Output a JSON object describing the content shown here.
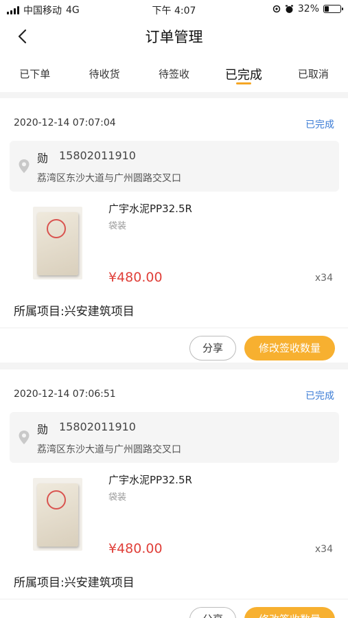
{
  "status_bar": {
    "carrier": "中国移动",
    "network": "4G",
    "time": "下午 4:07",
    "battery": "32%",
    "battery_level": 0.32
  },
  "nav": {
    "title": "订单管理"
  },
  "tabs": [
    {
      "label": "已下单"
    },
    {
      "label": "待收货"
    },
    {
      "label": "待签收"
    },
    {
      "label": "已完成"
    },
    {
      "label": "已取消"
    }
  ],
  "active_tab": "已完成",
  "orders": [
    {
      "datetime": "2020-12-14 07:07:04",
      "status": "已完成",
      "recipient_name": "勋",
      "phone": "15802011910",
      "address": "荔湾区东沙大道与广州圆路交叉口",
      "product_name": "广宇水泥PP32.5R",
      "product_spec": "袋装",
      "price": "¥480.00",
      "quantity": "x34",
      "project": "所属项目:兴安建筑项目",
      "share_label": "分享",
      "modify_label": "修改签收数量"
    },
    {
      "datetime": "2020-12-14 07:06:51",
      "status": "已完成",
      "recipient_name": "勋",
      "phone": "15802011910",
      "address": "荔湾区东沙大道与广州圆路交叉口",
      "product_name": "广宇水泥PP32.5R",
      "product_spec": "袋装",
      "price": "¥480.00",
      "quantity": "x34",
      "project": "所属项目:兴安建筑项目",
      "share_label": "分享",
      "modify_label": "修改签收数量"
    }
  ],
  "colors": {
    "accent": "#f5a623",
    "status_blue": "#3a7bd5",
    "price_red": "#e0403a",
    "button_orange": "#f7b030"
  }
}
